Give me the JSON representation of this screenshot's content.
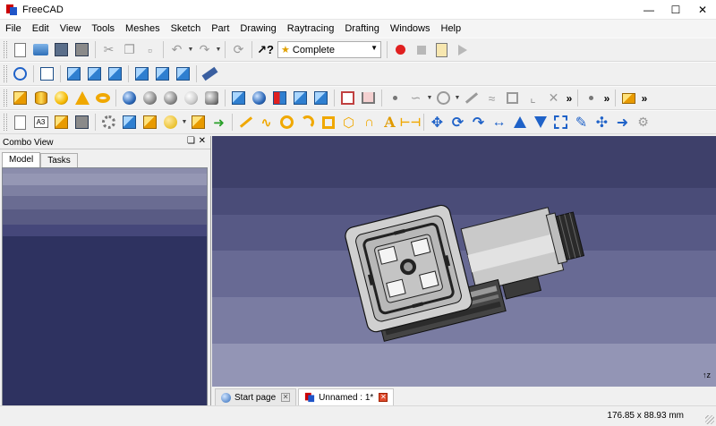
{
  "window": {
    "title": "FreeCAD"
  },
  "menu": [
    "File",
    "Edit",
    "View",
    "Tools",
    "Meshes",
    "Sketch",
    "Part",
    "Drawing",
    "Raytracing",
    "Drafting",
    "Windows",
    "Help"
  ],
  "toolbar": {
    "workbench_selected": "Complete",
    "overflow": "»"
  },
  "combo_view": {
    "title": "Combo View",
    "tabs": [
      "Model",
      "Tasks"
    ]
  },
  "document_tabs": [
    {
      "label": "Start page",
      "active": false
    },
    {
      "label": "Unnamed : 1*",
      "active": true
    }
  ],
  "viewport": {
    "axis_label": "z"
  },
  "status": {
    "dimensions": "176.85 x 88.93 mm"
  },
  "colors": {
    "viewport_bg": "#50527e",
    "tree_bg": "#2e3260",
    "record": "#e02020",
    "accent_blue": "#1f62c8",
    "part_orange": "#f0a800"
  }
}
